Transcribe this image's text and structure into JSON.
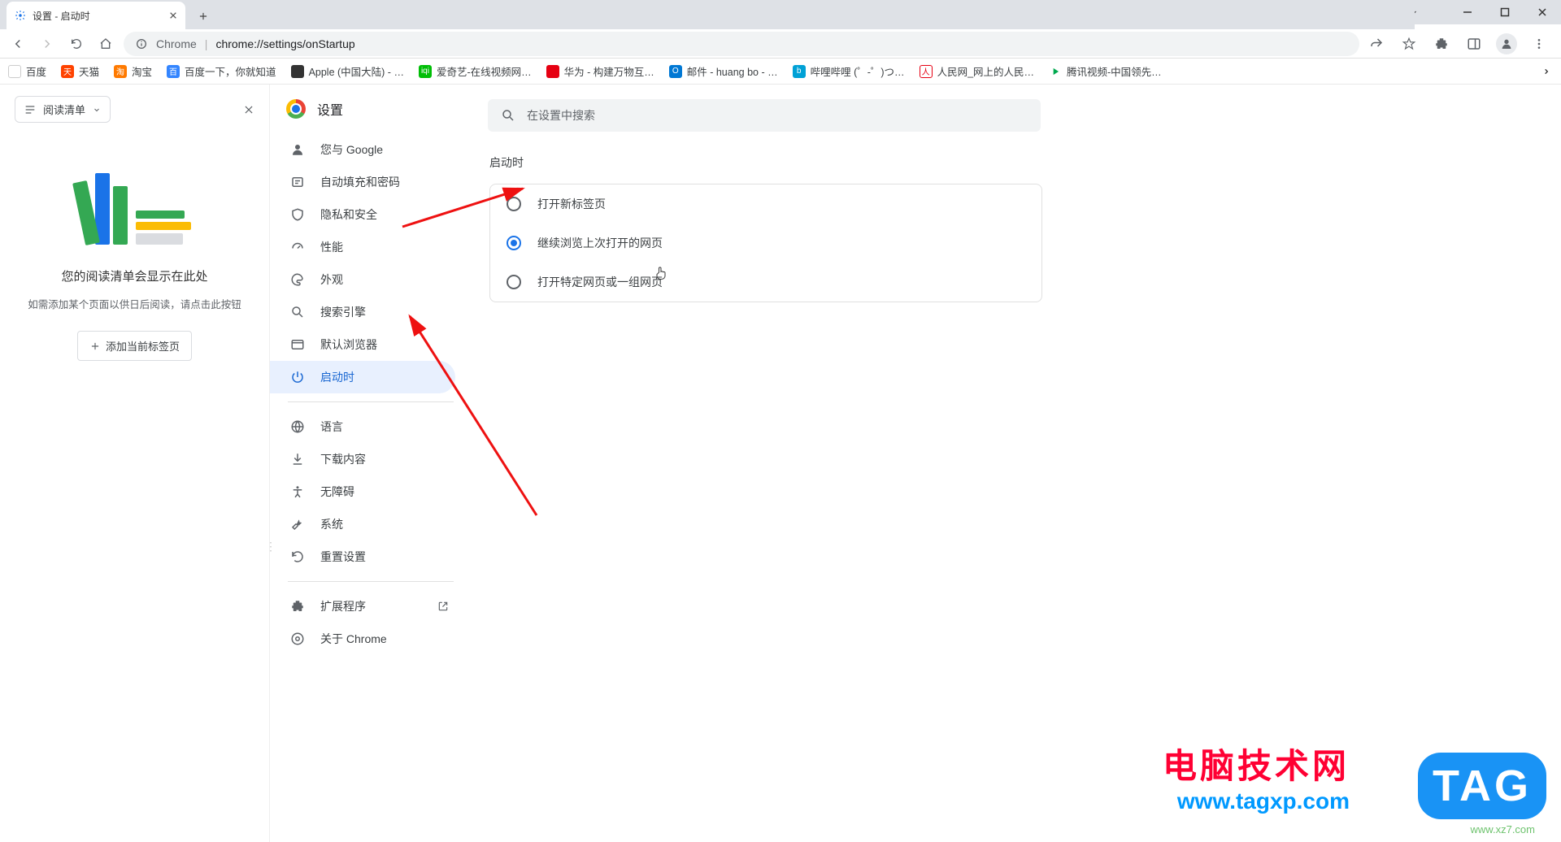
{
  "window": {
    "tab_title": "设置 - 启动时",
    "url_chrome": "Chrome",
    "url_path": "chrome://settings/onStartup"
  },
  "bookmarks": [
    {
      "label": "百度"
    },
    {
      "label": "天猫"
    },
    {
      "label": "淘宝"
    },
    {
      "label": "百度一下，你就知道"
    },
    {
      "label": "Apple (中国大陆) - …"
    },
    {
      "label": "爱奇艺-在线视频网…"
    },
    {
      "label": "华为 - 构建万物互…"
    },
    {
      "label": "邮件 - huang bo - …"
    },
    {
      "label": "哔哩哔哩 (゜-゜)つ…"
    },
    {
      "label": "人民网_网上的人民…"
    },
    {
      "label": "腾讯视频-中国领先…"
    }
  ],
  "sidepanel": {
    "dropdown_label": "阅读清单",
    "title": "您的阅读清单会显示在此处",
    "subtitle": "如需添加某个页面以供日后阅读，请点击此按钮",
    "add_button": "添加当前标签页"
  },
  "settings": {
    "title": "设置",
    "search_placeholder": "在设置中搜索",
    "nav": {
      "you_and_google": "您与 Google",
      "autofill": "自动填充和密码",
      "privacy": "隐私和安全",
      "performance": "性能",
      "appearance": "外观",
      "search_engine": "搜索引擎",
      "default_browser": "默认浏览器",
      "on_startup": "启动时",
      "languages": "语言",
      "downloads": "下载内容",
      "accessibility": "无障碍",
      "system": "系统",
      "reset": "重置设置",
      "extensions": "扩展程序",
      "about": "关于 Chrome"
    },
    "section_title": "启动时",
    "options": {
      "new_tab": "打开新标签页",
      "continue": "继续浏览上次打开的网页",
      "specific": "打开特定网页或一组网页"
    }
  },
  "watermarks": {
    "site_cn": "电脑技术网",
    "site_url": "www.tagxp.com",
    "tag": "TAG",
    "xz": "www.xz7.com"
  }
}
